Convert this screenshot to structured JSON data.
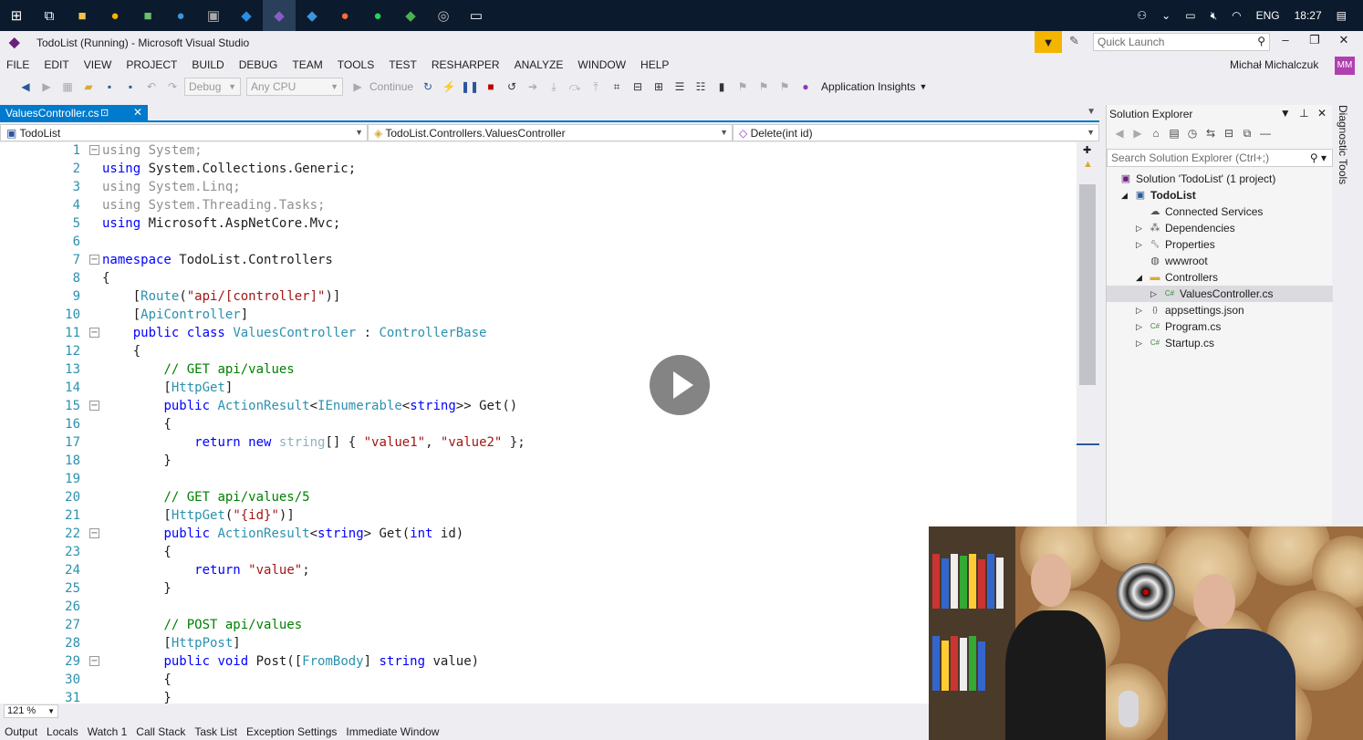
{
  "taskbar": {
    "icons": [
      {
        "name": "windows-start-icon",
        "glyph": "⊞",
        "color": "#ffffff"
      },
      {
        "name": "task-view-icon",
        "glyph": "⧉",
        "color": "#ffffff"
      },
      {
        "name": "file-explorer-icon",
        "glyph": "■",
        "color": "#f2c24c"
      },
      {
        "name": "chrome-icon",
        "glyph": "●",
        "color": "#f4b400"
      },
      {
        "name": "notepad-icon",
        "glyph": "■",
        "color": "#6abf69"
      },
      {
        "name": "edge-icon",
        "glyph": "●",
        "color": "#3a96dd"
      },
      {
        "name": "terminal-icon",
        "glyph": "▣",
        "color": "#aaaaaa"
      },
      {
        "name": "vscode-icon",
        "glyph": "◆",
        "color": "#2b8ee0"
      },
      {
        "name": "visual-studio-icon",
        "glyph": "◆",
        "color": "#8a5cc8"
      },
      {
        "name": "app-blue-icon",
        "glyph": "◆",
        "color": "#3a96dd"
      },
      {
        "name": "postman-icon",
        "glyph": "●",
        "color": "#ff6c37"
      },
      {
        "name": "spotify-icon",
        "glyph": "●",
        "color": "#1ed760"
      },
      {
        "name": "sourcetree-icon",
        "glyph": "◆",
        "color": "#4caf50"
      },
      {
        "name": "settings-app-icon",
        "glyph": "◎",
        "color": "#bbbbbb"
      },
      {
        "name": "window-app-icon",
        "glyph": "▭",
        "color": "#ffffff"
      }
    ],
    "tray_language": "ENG",
    "tray_time": "18:27"
  },
  "window": {
    "title": "TodoList (Running) - Microsoft Visual Studio",
    "quick_launch_placeholder": "Quick Launch"
  },
  "menu": [
    "FILE",
    "EDIT",
    "VIEW",
    "PROJECT",
    "BUILD",
    "DEBUG",
    "TEAM",
    "TOOLS",
    "TEST",
    "RESHARPER",
    "ANALYZE",
    "WINDOW",
    "HELP"
  ],
  "user": {
    "name": "Michał Michalczuk",
    "initials": "MM"
  },
  "toolbar": {
    "config": "Debug",
    "platform": "Any CPU",
    "continue_label": "Continue",
    "app_insights_label": "Application Insights"
  },
  "doc_tab": {
    "label": "ValuesController.cs"
  },
  "nav": {
    "project": "TodoList",
    "class": "TodoList.Controllers.ValuesController",
    "member": "Delete(int id)"
  },
  "code": [
    "1",
    "2",
    "3",
    "4",
    "5",
    "6",
    "7",
    "8",
    "9",
    "10",
    "11",
    "12",
    "13",
    "14",
    "15",
    "16",
    "17",
    "18",
    "19",
    "20",
    "21",
    "22",
    "23",
    "24",
    "25",
    "26",
    "27",
    "28",
    "29",
    "30",
    "31"
  ],
  "zoom": "121 %",
  "bottom_tabs": [
    "Output",
    "Locals",
    "Watch 1",
    "Call Stack",
    "Task List",
    "Exception Settings",
    "Immediate Window"
  ],
  "solution_explorer": {
    "title": "Solution Explorer",
    "search_placeholder": "Search Solution Explorer (Ctrl+;)",
    "items": [
      {
        "label": "Solution 'TodoList' (1 project)",
        "icon": "solution-icon"
      },
      {
        "label": "TodoList",
        "icon": "project-icon"
      },
      {
        "label": "Connected Services",
        "icon": "cloud-icon"
      },
      {
        "label": "Dependencies",
        "icon": "dependencies-icon"
      },
      {
        "label": "Properties",
        "icon": "wrench-icon"
      },
      {
        "label": "wwwroot",
        "icon": "globe-icon"
      },
      {
        "label": "Controllers",
        "icon": "folder-icon"
      },
      {
        "label": "ValuesController.cs",
        "icon": "csharp-file-icon"
      },
      {
        "label": "appsettings.json",
        "icon": "json-file-icon"
      },
      {
        "label": "Program.cs",
        "icon": "csharp-file-icon"
      },
      {
        "label": "Startup.cs",
        "icon": "csharp-file-icon"
      }
    ]
  },
  "diagnostic_tools_label": "Diagnostic Tools"
}
